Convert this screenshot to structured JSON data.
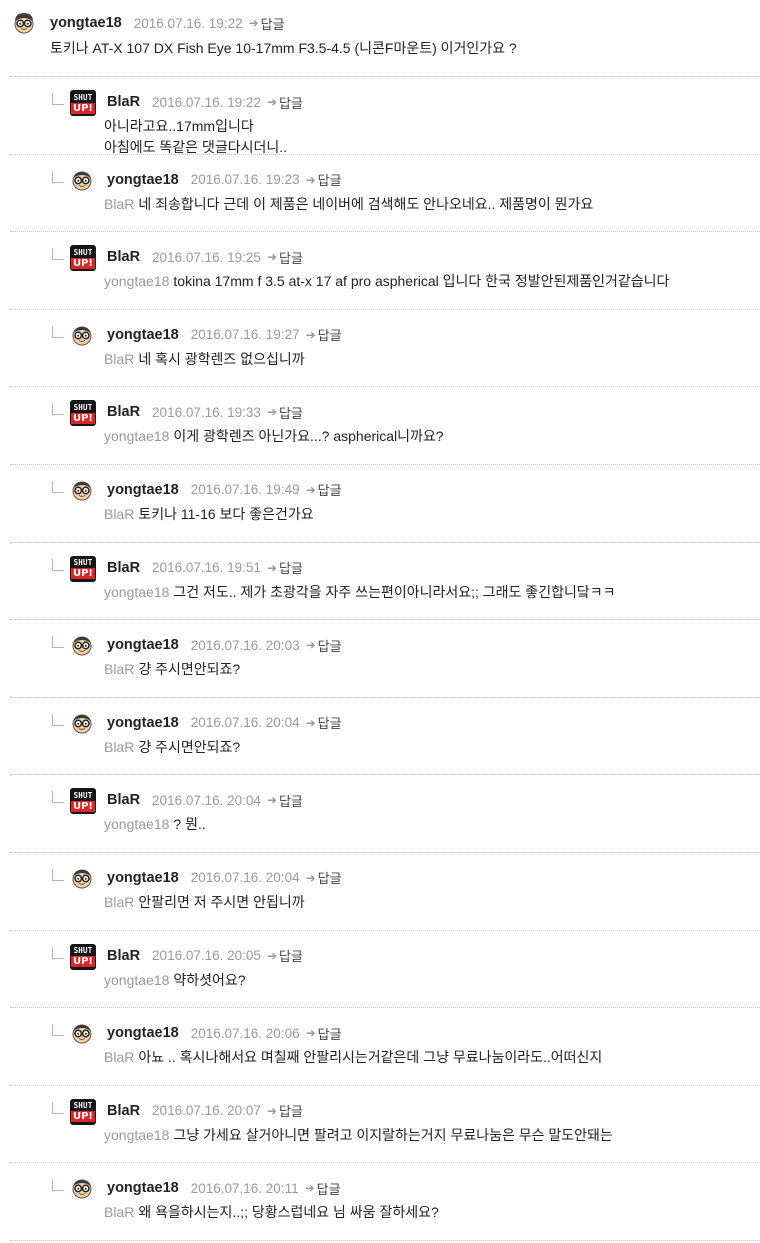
{
  "reply_label": "답글",
  "colors": {
    "mention": "#9a9a9a",
    "separator": "#c9c9c9",
    "badge_red": "#d9262a"
  },
  "icons": {
    "face": "glasses-face-avatar-icon",
    "shut": "shut-up-badge-icon",
    "reply": "reply-arrow-icon"
  },
  "badge": {
    "line1": "SHUT",
    "line2": "UP!"
  },
  "root": {
    "author": "yongtae18",
    "date": "2016.07.16. 19:22",
    "text": "토키나 AT-X 107 DX Fish Eye 10-17mm F3.5-4.5 (니콘F마운트) 이거인가요 ?"
  },
  "replies": [
    {
      "author": "BlaR",
      "avatar": "shut",
      "date": "2016.07.16. 19:22",
      "mention": "",
      "lines": [
        "아니라고요..17mm입니다",
        "아침에도 똑같은 댓글다시더니.."
      ]
    },
    {
      "author": "yongtae18",
      "avatar": "face",
      "date": "2016.07.16. 19:23",
      "mention": "BlaR",
      "lines": [
        "네 죄송합니다 근데 이 제품은 네이버에 검색해도 안나오네요.. 제품명이 뭔가요"
      ]
    },
    {
      "author": "BlaR",
      "avatar": "shut",
      "date": "2016.07.16. 19:25",
      "mention": "yongtae18",
      "lines": [
        "tokina 17mm f 3.5 at-x 17 af pro aspherical 입니다 한국 정발안된제품인거같습니다"
      ]
    },
    {
      "author": "yongtae18",
      "avatar": "face",
      "date": "2016.07.16. 19:27",
      "mention": "BlaR",
      "lines": [
        "네 혹시 광학렌즈 없으십니까"
      ]
    },
    {
      "author": "BlaR",
      "avatar": "shut",
      "date": "2016.07.16. 19:33",
      "mention": "yongtae18",
      "lines": [
        "이게 광학렌즈 아닌가요...? aspherical니까요?"
      ]
    },
    {
      "author": "yongtae18",
      "avatar": "face",
      "date": "2016.07.16. 19:49",
      "mention": "BlaR",
      "lines": [
        "토키나 11-16 보다 좋은건가요"
      ]
    },
    {
      "author": "BlaR",
      "avatar": "shut",
      "date": "2016.07.16. 19:51",
      "mention": "yongtae18",
      "lines": [
        "그건 저도.. 제가 초광각을 자주 쓰는편이아니라서요;; 그래도 좋긴합니닼ㅋㅋ"
      ]
    },
    {
      "author": "yongtae18",
      "avatar": "face",
      "date": "2016.07.16. 20:03",
      "mention": "BlaR",
      "lines": [
        "걍 주시면안되죠?"
      ]
    },
    {
      "author": "yongtae18",
      "avatar": "face",
      "date": "2016.07.16. 20:04",
      "mention": "BlaR",
      "lines": [
        "걍 주시면안되죠?"
      ]
    },
    {
      "author": "BlaR",
      "avatar": "shut",
      "date": "2016.07.16. 20:04",
      "mention": "yongtae18",
      "lines": [
        "? 뭔.."
      ]
    },
    {
      "author": "yongtae18",
      "avatar": "face",
      "date": "2016.07.16. 20:04",
      "mention": "BlaR",
      "lines": [
        "안팔리면 저 주시면 안됩니까"
      ]
    },
    {
      "author": "BlaR",
      "avatar": "shut",
      "date": "2016.07.16. 20:05",
      "mention": "yongtae18",
      "lines": [
        "약하셧어요?"
      ]
    },
    {
      "author": "yongtae18",
      "avatar": "face",
      "date": "2016.07.16. 20:06",
      "mention": "BlaR",
      "lines": [
        "아뇨 .. 혹시나해서요 며칠째 안팔리시는거같은데 그냥 무료나눔이라도..어떠신지"
      ]
    },
    {
      "author": "BlaR",
      "avatar": "shut",
      "date": "2016.07.16. 20:07",
      "mention": "yongtae18",
      "lines": [
        "그냥 가세요 살거아니면 팔려고 이지랄하는거지 무료나눔은 무슨 말도안돼는"
      ]
    },
    {
      "author": "yongtae18",
      "avatar": "face",
      "date": "2016.07.16. 20:11",
      "mention": "BlaR",
      "lines": [
        "왜 욕을하시는지..;; 당황스럽네요 님 싸움 잘하세요?"
      ]
    }
  ]
}
